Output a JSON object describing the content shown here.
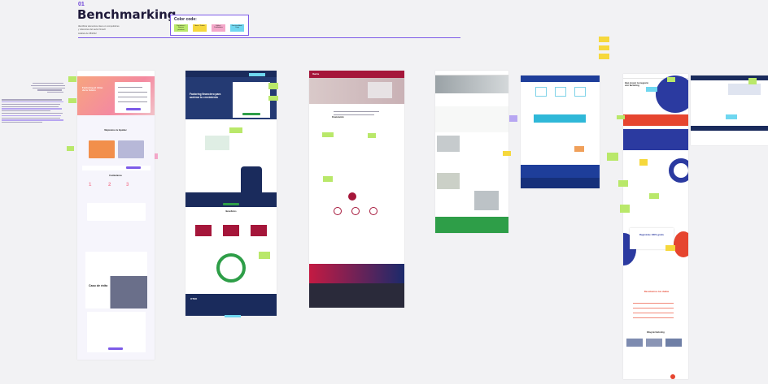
{
  "header": {
    "section_number": "01",
    "title": "Benchmarking",
    "description_lines": [
      "Identificar elementos clave en competidores",
      "y referentes del sector fintech",
      "Análisis de 08/2022"
    ]
  },
  "color_code": {
    "title": "Color code:",
    "items": [
      {
        "label": "Fortalezas / Buenas prácticas",
        "color": "#b9e86a"
      },
      {
        "label": "Ideas / Dudas",
        "color": "#f6d83c"
      },
      {
        "label": "Fallos / Debilidades",
        "color": "#f4a7c9"
      },
      {
        "label": "Funcionalidad / Copy",
        "color": "#6fd7f0"
      }
    ]
  },
  "colors": {
    "accent": "#7d5be8",
    "navy": "#1a2b5c",
    "crimson": "#a5163a",
    "green": "#2e9e48",
    "blue": "#1e3e9a"
  },
  "screens": [
    {
      "name": "fintech-landing-coral",
      "hero_title": "Factoring al ritmo de tu futuro",
      "section_title": "Mejoramos tu liquidez",
      "cta": "Contáctanos",
      "case_title": "Caso de éxito"
    },
    {
      "name": "factoring-navy",
      "hero_title": "Factoring financiero para acelerar tu crecimiento",
      "section_title": "Beneficios",
      "footer_brand": "OTEK"
    },
    {
      "name": "bank-crimson",
      "hero_brand": "Iberia",
      "section_title": "Financiación"
    },
    {
      "name": "corporate-green"
    },
    {
      "name": "bank-blue"
    },
    {
      "name": "fintech-indigo",
      "hero_title": "Haz crecer tu negocio con factoring",
      "offer_title": "Regístrate 100% gratis",
      "faq_title": "Resolvemos tus dudas",
      "blog_title": "Blog de factoring"
    }
  ]
}
